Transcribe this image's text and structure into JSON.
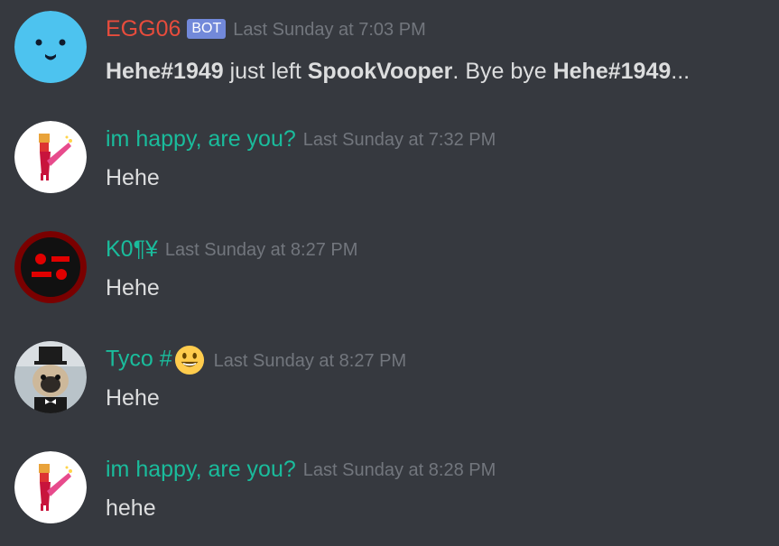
{
  "colors": {
    "background": "#36393f",
    "bot_name": "#e74c3c",
    "teal_name": "#1abc9c",
    "bot_tag": "#7289da",
    "timestamp": "#72767d",
    "text": "#dcddde"
  },
  "messages": [
    {
      "author": "EGG06",
      "bot_tag": "BOT",
      "timestamp": "Last Sunday at 7:03 PM",
      "avatar_icon": "blue-face-avatar",
      "content": {
        "user1": "Hehe#1949",
        "t1": " just left ",
        "server": "SpookVooper",
        "t2": ". Bye bye ",
        "user2": "Hehe#1949",
        "t3": "..."
      }
    },
    {
      "author": "im happy, are you?",
      "timestamp": "Last Sunday at 7:32 PM",
      "avatar_icon": "pink-figure-avatar",
      "content": "Hehe"
    },
    {
      "author": "K0¶¥",
      "timestamp": "Last Sunday at 8:27 PM",
      "avatar_icon": "red-robot-avatar",
      "content": "Hehe"
    },
    {
      "author": "Tyco #",
      "emoji": "smiley-emoji",
      "timestamp": "Last Sunday at 8:27 PM",
      "avatar_icon": "pug-top-hat-avatar",
      "content": "Hehe"
    },
    {
      "author": "im happy, are you?",
      "timestamp": "Last Sunday at 8:28 PM",
      "avatar_icon": "pink-figure-avatar",
      "content": "hehe"
    }
  ]
}
